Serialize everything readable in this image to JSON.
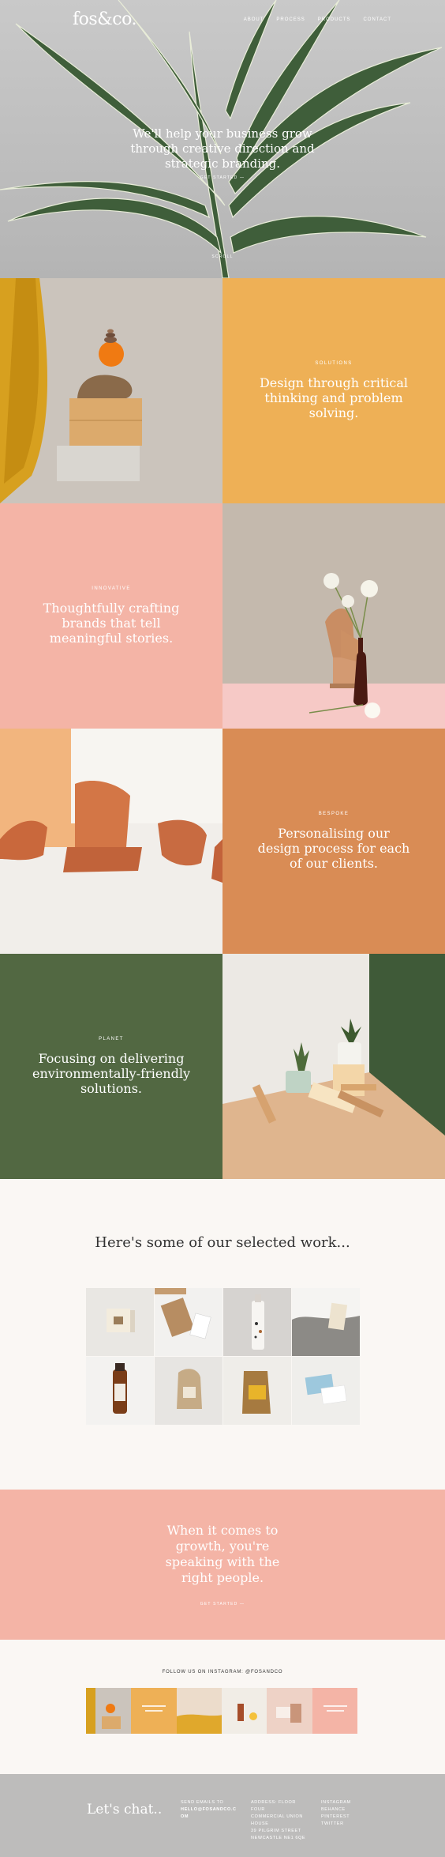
{
  "header": {
    "logo": "fos&co.",
    "nav": [
      "ABOUT",
      "PROCESS",
      "PRODUCTS",
      "CONTACT"
    ]
  },
  "hero": {
    "title_line1": "We'll help your business grow",
    "title_line2": "through creative direction and",
    "title_line3": "strategic branding.",
    "cta": "GET STARTED —",
    "scroll": "SCROLL"
  },
  "sections": [
    {
      "kicker": "SOLUTIONS",
      "title": "Design through critical thinking and problem solving.",
      "color": "#eeb056"
    },
    {
      "kicker": "INNOVATIVE",
      "title": "Thoughtfully crafting brands that tell meaningful stories.",
      "color": "#f4b4a6"
    },
    {
      "kicker": "BESPOKE",
      "title": "Personalising our design process for each of our clients.",
      "color": "#d98c55"
    },
    {
      "kicker": "PLANET",
      "title": "Focusing on delivering environmentally-friendly solutions.",
      "color": "#526842"
    }
  ],
  "work": {
    "title": "Here's some of our selected work...",
    "thumbnails": [
      "work-1",
      "work-2",
      "work-3",
      "work-4",
      "work-5",
      "work-6",
      "work-7",
      "work-8"
    ]
  },
  "cta": {
    "title_line1": "When it comes to",
    "title_line2": "growth, you're",
    "title_line3": "speaking with the",
    "title_line4": "right people.",
    "link": "GET STARTED —"
  },
  "instagram": {
    "title": "FOLLOW US ON INSTAGRAM: @FOSANDCO"
  },
  "footer": {
    "chat": "Let's chat..",
    "email_label": "SEND EMAILS TO",
    "email_line1": "HELLO@FOSANDCO.C",
    "email_line2": "OM",
    "address": [
      "ADDRESS: FLOOR",
      "FOUR",
      "COMMERCIAL UNION",
      "HOUSE",
      "39 PILGRIM STREET",
      "NEWCASTLE NE1 6QE"
    ],
    "social": [
      "INSTAGRAM",
      "BEHANCE",
      "PINTEREST",
      "TWITTER"
    ]
  }
}
